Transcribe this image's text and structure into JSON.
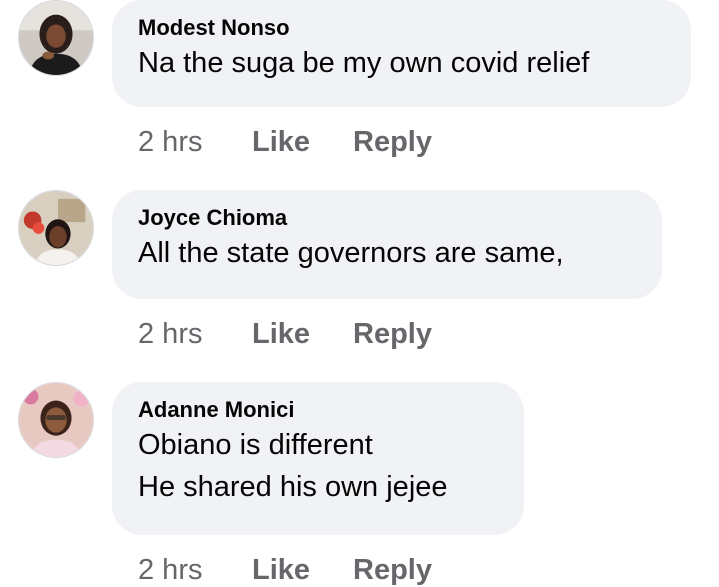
{
  "comments": [
    {
      "author": "Modest Nonso",
      "lines": [
        "Na the suga be my own covid relief"
      ],
      "time": "2 hrs",
      "like_label": "Like",
      "reply_label": "Reply",
      "avatar_icon": "profile-photo"
    },
    {
      "author": "Joyce Chioma",
      "lines": [
        "All the state governors are same,"
      ],
      "time": "2 hrs",
      "like_label": "Like",
      "reply_label": "Reply",
      "avatar_icon": "profile-photo"
    },
    {
      "author": "Adanne Monici",
      "lines": [
        "Obiano is different",
        "He shared his own jejee"
      ],
      "time": "2 hrs",
      "like_label": "Like",
      "reply_label": "Reply",
      "avatar_icon": "profile-photo"
    }
  ],
  "colors": {
    "bubble": "#f0f2f5",
    "text": "#050505",
    "muted": "#65676b"
  }
}
